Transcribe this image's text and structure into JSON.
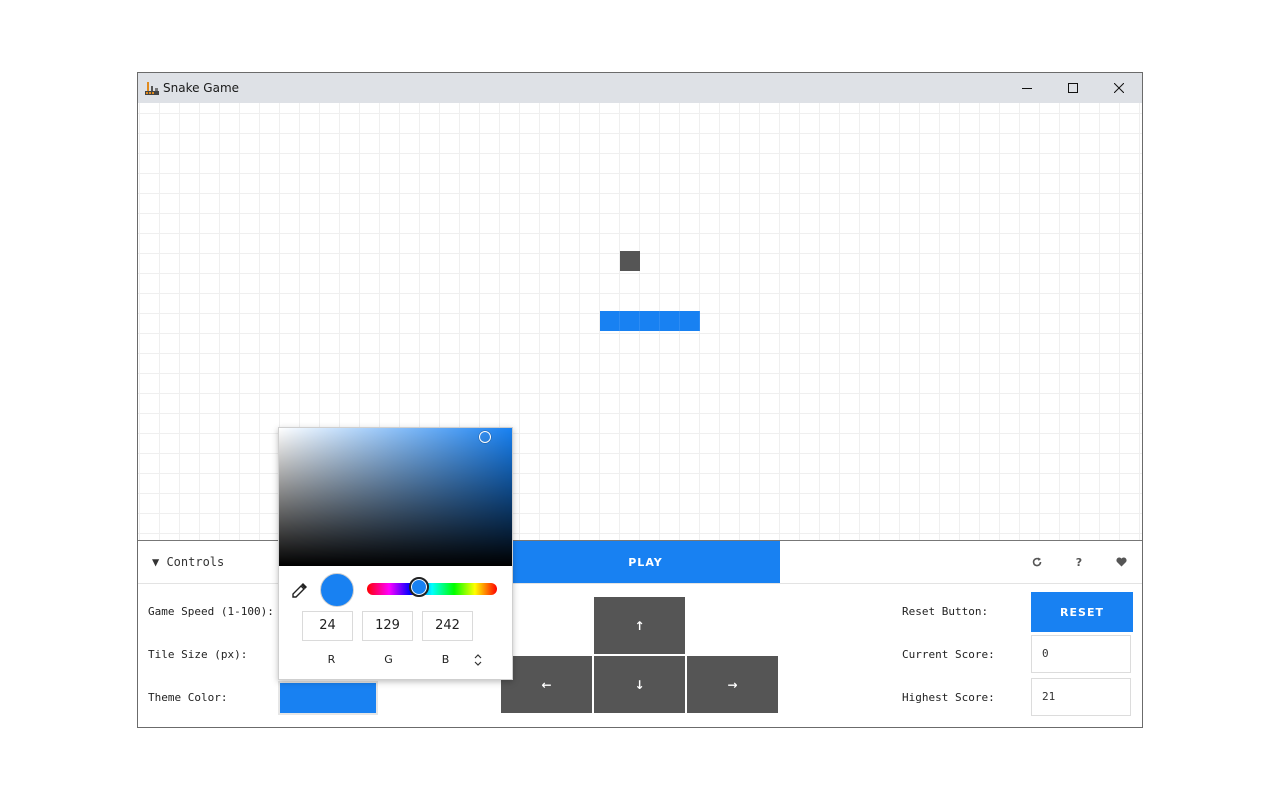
{
  "window": {
    "title": "Snake Game"
  },
  "controls": {
    "toggle_label": "▼ Controls",
    "play_label": "PLAY",
    "game_speed_label": "Game Speed (1-100):",
    "tile_size_label": "Tile Size (px):",
    "theme_color_label": "Theme Color:",
    "reset_label": "Reset Button:",
    "reset_button": "RESET",
    "current_score_label": "Current Score:",
    "current_score": "0",
    "highest_score_label": "Highest Score:",
    "highest_score": "21"
  },
  "toolbar_icons": [
    "refresh-icon",
    "help-icon",
    "heart-icon"
  ],
  "arrow_glyphs": {
    "up": "↑",
    "left": "←",
    "down": "↓",
    "right": "→"
  },
  "color_picker": {
    "r": "24",
    "g": "129",
    "b": "242",
    "r_label": "R",
    "g_label": "G",
    "b_label": "B"
  },
  "colors": {
    "theme": "#1881f2",
    "food": "#555555",
    "arrow_buttons": "#555555",
    "titlebar": "#dee1e6"
  }
}
